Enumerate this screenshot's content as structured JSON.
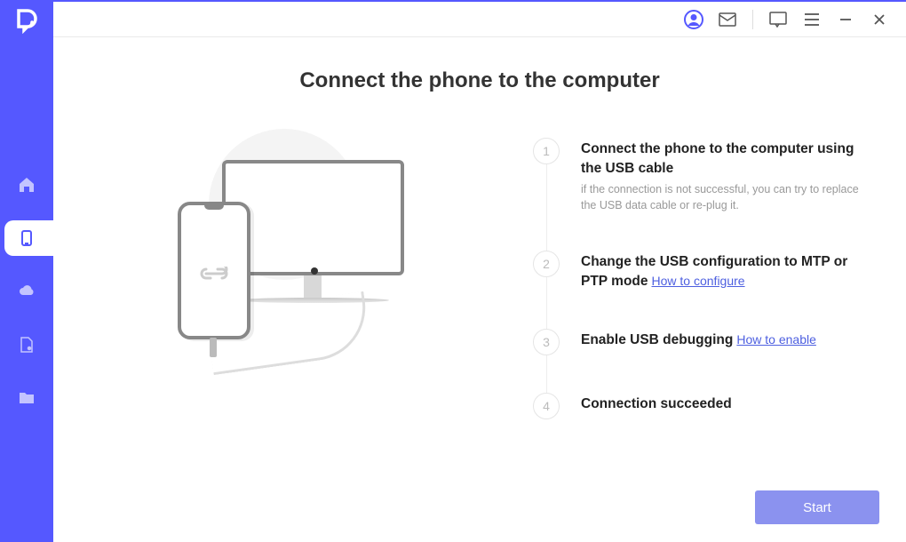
{
  "sidebar": {
    "items": [
      {
        "name": "home",
        "active": false
      },
      {
        "name": "phone",
        "active": true
      },
      {
        "name": "cloud",
        "active": false
      },
      {
        "name": "file",
        "active": false
      },
      {
        "name": "folder",
        "active": false
      }
    ]
  },
  "titlebar": {
    "icons": [
      "account",
      "mail",
      "chat",
      "menu",
      "minimize",
      "close"
    ]
  },
  "page": {
    "title": "Connect the phone to the computer",
    "steps": [
      {
        "num": "1",
        "title": "Connect the phone to the computer using the USB cable",
        "hint": "if the connection is not successful, you can try to replace the USB data cable or re-plug it.",
        "link": ""
      },
      {
        "num": "2",
        "title": "Change the USB configuration to MTP or PTP mode",
        "hint": "",
        "link": "How to configure"
      },
      {
        "num": "3",
        "title": "Enable USB debugging",
        "hint": "",
        "link": "How to enable"
      },
      {
        "num": "4",
        "title": "Connection succeeded",
        "hint": "",
        "link": ""
      }
    ],
    "start_label": "Start"
  }
}
